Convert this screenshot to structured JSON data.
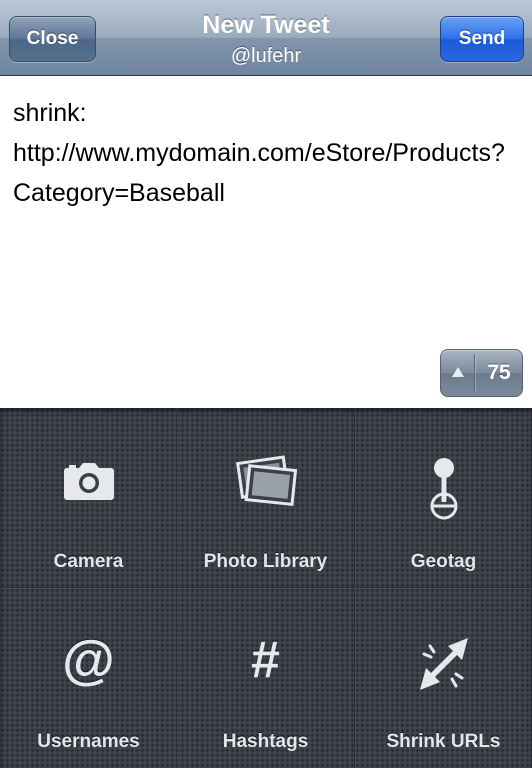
{
  "navbar": {
    "close_label": "Close",
    "title": "New Tweet",
    "subtitle": "@lufehr",
    "send_label": "Send"
  },
  "compose": {
    "text": "shrink:\nhttp://www.mydomain.com/eStore/Products?Category=Baseball",
    "char_remaining": "75"
  },
  "actions": [
    {
      "label": "Camera",
      "icon": "camera-icon"
    },
    {
      "label": "Photo Library",
      "icon": "photo-library-icon"
    },
    {
      "label": "Geotag",
      "icon": "geotag-pin-icon"
    },
    {
      "label": "Usernames",
      "icon": "at-sign-icon"
    },
    {
      "label": "Hashtags",
      "icon": "hash-icon"
    },
    {
      "label": "Shrink URLs",
      "icon": "shrink-arrows-icon"
    }
  ],
  "colors": {
    "navbar": "#8396ad",
    "send_button": "#2d6fe6",
    "grid_background": "#3a3f48"
  }
}
